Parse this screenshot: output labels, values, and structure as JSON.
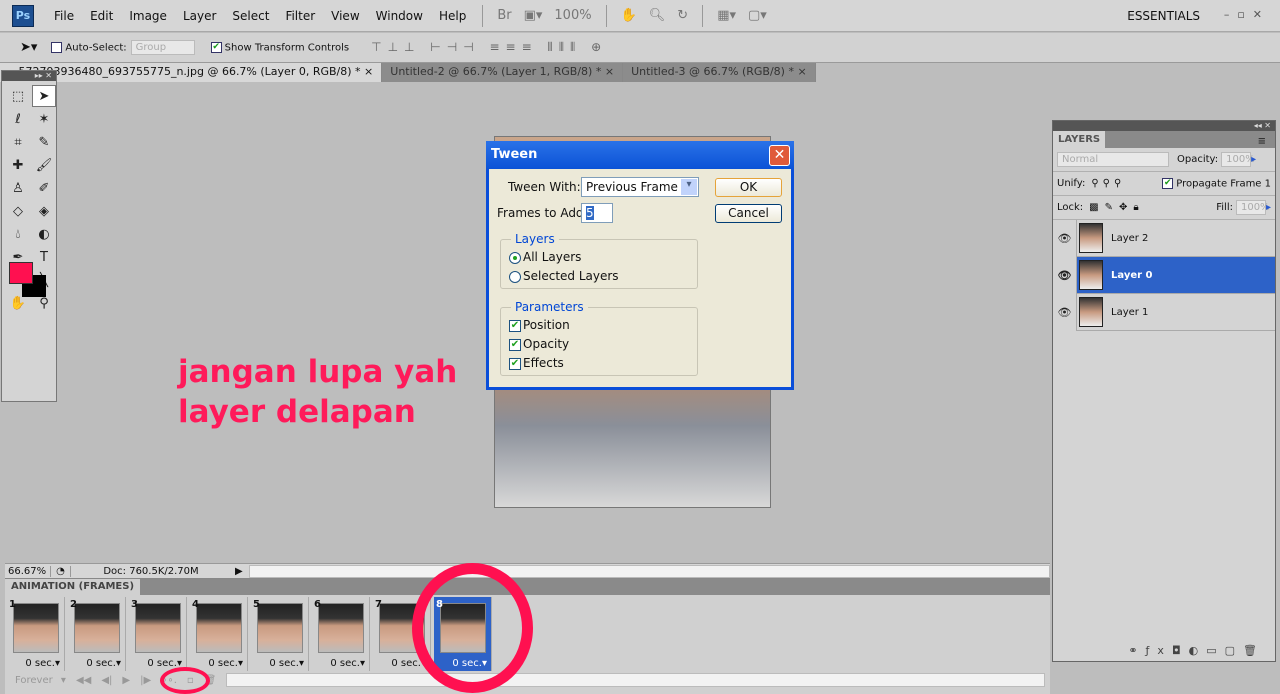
{
  "app": {
    "logo": "Ps",
    "workspace": "ESSENTIALS",
    "zoom_display": "100%"
  },
  "menu": [
    "File",
    "Edit",
    "Image",
    "Layer",
    "Select",
    "Filter",
    "View",
    "Window",
    "Help"
  ],
  "options": {
    "auto_select_label": "Auto-Select:",
    "auto_select_checked": false,
    "auto_select_value": "Group",
    "show_transform_label": "Show Transform Controls",
    "show_transform_checked": true
  },
  "tabs": [
    {
      "label": "...572793936480_693755775_n.jpg @ 66.7% (Layer 0, RGB/8) *",
      "active": true
    },
    {
      "label": "Untitled-2 @ 66.7% (Layer 1, RGB/8) *",
      "active": false
    },
    {
      "label": "Untitled-3 @ 66.7% (RGB/8) *",
      "active": false
    }
  ],
  "colors": {
    "foreground": "#ff1050",
    "background": "#000000",
    "annotation": "#ff1a5a",
    "selection": "#2d62c8"
  },
  "annotation": {
    "line1": "jangan lupa yah",
    "line2": "layer delapan"
  },
  "dialog": {
    "title": "Tween",
    "tween_with_label": "Tween With:",
    "tween_with_value": "Previous Frame",
    "frames_to_add_label": "Frames to Add:",
    "frames_to_add_value": "5",
    "ok": "OK",
    "cancel": "Cancel",
    "layers_group": "Layers",
    "all_layers": "All Layers",
    "selected_layers": "Selected Layers",
    "layers_choice": "All Layers",
    "parameters_group": "Parameters",
    "position": "Position",
    "opacity": "Opacity",
    "effects": "Effects"
  },
  "status": {
    "zoom": "66.67%",
    "doc": "Doc: 760.5K/2.70M"
  },
  "animation": {
    "panel_title": "ANIMATION (FRAMES)",
    "loop": "Forever",
    "frames": [
      {
        "n": "1",
        "dur": "0 sec."
      },
      {
        "n": "2",
        "dur": "0 sec."
      },
      {
        "n": "3",
        "dur": "0 sec."
      },
      {
        "n": "4",
        "dur": "0 sec."
      },
      {
        "n": "5",
        "dur": "0 sec."
      },
      {
        "n": "6",
        "dur": "0 sec."
      },
      {
        "n": "7",
        "dur": "0 sec."
      },
      {
        "n": "8",
        "dur": "0 sec.",
        "selected": true
      }
    ]
  },
  "layers_panel": {
    "title": "LAYERS",
    "blend": "Normal",
    "opacity_label": "Opacity:",
    "opacity": "100%",
    "unify_label": "Unify:",
    "propagate_label": "Propagate Frame 1",
    "propagate_checked": true,
    "lock_label": "Lock:",
    "fill_label": "Fill:",
    "fill": "100%",
    "layers": [
      {
        "name": "Layer 2"
      },
      {
        "name": "Layer 0",
        "selected": true
      },
      {
        "name": "Layer 1"
      }
    ]
  }
}
